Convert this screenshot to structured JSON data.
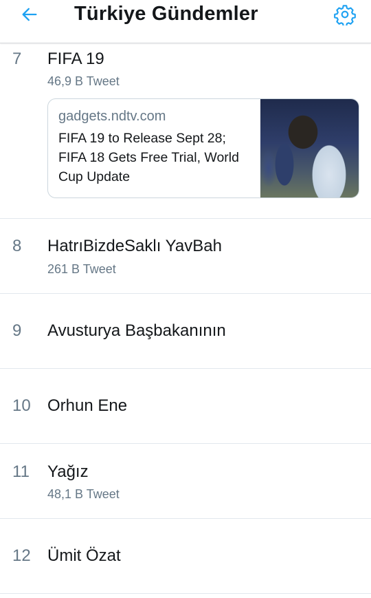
{
  "header": {
    "title": "Türkiye Gündemler",
    "back_icon": "arrow-left-icon",
    "settings_icon": "gear-icon",
    "accent_color": "#1da1f2"
  },
  "trends": [
    {
      "rank": "7",
      "topic": "FIFA 19",
      "tweet_count": "46,9 B Tweet",
      "card": {
        "domain": "gadgets.ndtv.com",
        "headline": "FIFA 19 to Release Sept 28; FIFA 18 Gets Free Trial, World Cup Update"
      }
    },
    {
      "rank": "8",
      "topic": "HatrıBizdeSaklı YavBah",
      "tweet_count": "261 B Tweet"
    },
    {
      "rank": "9",
      "topic": "Avusturya Başbakanının"
    },
    {
      "rank": "10",
      "topic": "Orhun Ene"
    },
    {
      "rank": "11",
      "topic": "Yağız",
      "tweet_count": "48,1 B Tweet"
    },
    {
      "rank": "12",
      "topic": "Ümit Özat"
    }
  ]
}
